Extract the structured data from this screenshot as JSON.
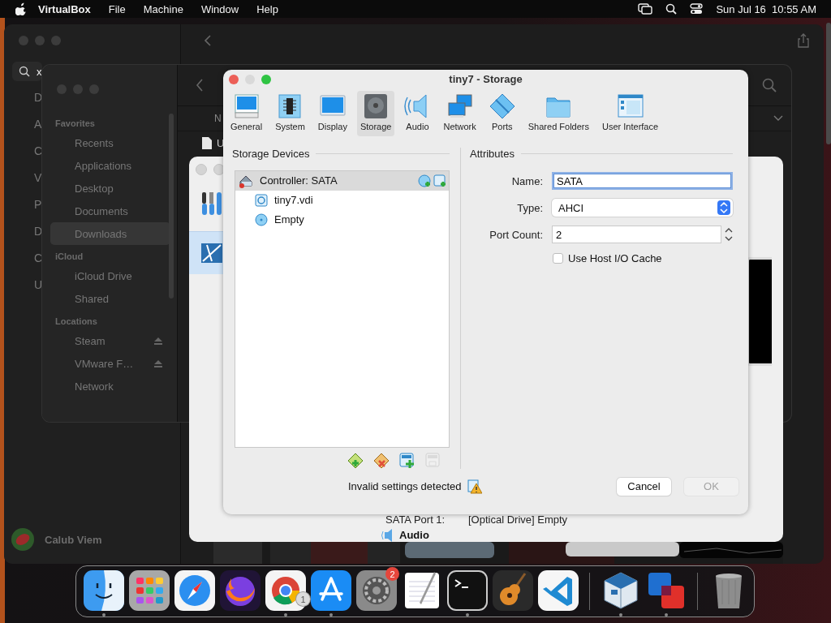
{
  "menu_bar": {
    "app": "VirtualBox",
    "menus": [
      "File",
      "Machine",
      "Window",
      "Help"
    ],
    "clock": "Sun Jul 16  10:55 AM"
  },
  "finder_back": {
    "search_value": "x",
    "sidebar_letters": [
      "D",
      "A",
      "C",
      "V",
      "P",
      "D",
      "C",
      "U"
    ],
    "user": "Calub Viem"
  },
  "finder_front": {
    "sidebar": [
      {
        "heading": "Favorites",
        "items": [
          {
            "label": "Recents",
            "selected": false,
            "ejectable": false
          },
          {
            "label": "Applications",
            "selected": false,
            "ejectable": false
          },
          {
            "label": "Desktop",
            "selected": false,
            "ejectable": false
          },
          {
            "label": "Documents",
            "selected": false,
            "ejectable": false
          },
          {
            "label": "Downloads",
            "selected": true,
            "ejectable": false
          }
        ]
      },
      {
        "heading": "iCloud",
        "items": [
          {
            "label": "iCloud Drive",
            "selected": false,
            "ejectable": false
          },
          {
            "label": "Shared",
            "selected": false,
            "ejectable": false
          }
        ]
      },
      {
        "heading": "Locations",
        "items": [
          {
            "label": "Steam",
            "selected": false,
            "ejectable": true
          },
          {
            "label": "VMware F…",
            "selected": false,
            "ejectable": true
          },
          {
            "label": "Network",
            "selected": false,
            "ejectable": false
          }
        ]
      }
    ],
    "column_1": "N",
    "row_1": "U"
  },
  "vbox_main": {
    "details": [
      {
        "label": "SATA Port 1:",
        "value": "[Optical Drive] Empty"
      }
    ],
    "section": "Audio"
  },
  "dialog": {
    "title": "tiny7 - Storage",
    "pages": [
      {
        "label": "General",
        "kind": "general",
        "selected": false
      },
      {
        "label": "System",
        "kind": "system",
        "selected": false
      },
      {
        "label": "Display",
        "kind": "display",
        "selected": false
      },
      {
        "label": "Storage",
        "kind": "storage",
        "selected": true
      },
      {
        "label": "Audio",
        "kind": "audio",
        "selected": false
      },
      {
        "label": "Network",
        "kind": "network",
        "selected": false
      },
      {
        "label": "Ports",
        "kind": "ports",
        "selected": false
      },
      {
        "label": "Shared Folders",
        "kind": "folders",
        "selected": false
      },
      {
        "label": "User Interface",
        "kind": "ui",
        "selected": false
      }
    ],
    "devices_heading": "Storage Devices",
    "storage_tree": [
      {
        "label": "Controller: SATA",
        "kind": "controller",
        "selected": true,
        "children": [
          {
            "label": "tiny7.vdi",
            "kind": "disk",
            "selected": false
          },
          {
            "label": "Empty",
            "kind": "optical",
            "selected": false
          }
        ]
      }
    ],
    "tree_tools": [
      {
        "kind": "add-controller",
        "disabled": false
      },
      {
        "kind": "remove-controller",
        "disabled": false
      },
      {
        "kind": "add-attachment",
        "disabled": false
      },
      {
        "kind": "remove-attachment",
        "disabled": true
      }
    ],
    "attributes_heading": "Attributes",
    "attributes": [
      {
        "kind": "text",
        "label": "Name:",
        "value": "SATA",
        "focused": true
      },
      {
        "kind": "select",
        "label": "Type:",
        "value": "AHCI"
      },
      {
        "kind": "spin",
        "label": "Port Count:",
        "value": "2"
      },
      {
        "kind": "checkbox",
        "label": "Use Host I/O Cache",
        "checked": false
      }
    ],
    "message": "Invalid settings detected",
    "buttons": [
      {
        "label": "Cancel",
        "disabled": false
      },
      {
        "label": "OK",
        "disabled": true
      }
    ]
  },
  "dock": {
    "apps": [
      {
        "kind": "face",
        "running": true
      },
      {
        "kind": "grid",
        "running": false
      },
      {
        "kind": "compass",
        "running": false
      },
      {
        "kind": "fox",
        "running": false
      },
      {
        "kind": "ring",
        "running": true,
        "badge": {
          "text": "1",
          "kind": "progress"
        }
      },
      {
        "kind": "store",
        "running": true
      },
      {
        "kind": "gear",
        "running": false,
        "badge": {
          "text": "2",
          "kind": "alert"
        }
      },
      {
        "kind": "notepad",
        "running": false
      },
      {
        "kind": "terminal",
        "running": true
      },
      {
        "kind": "guitar",
        "running": false
      },
      {
        "kind": "code",
        "running": false
      },
      {
        "kind": "cube",
        "running": true,
        "group_start": true
      },
      {
        "kind": "squares",
        "running": true
      },
      {
        "kind": "trash",
        "running": false,
        "group_start": true
      }
    ]
  }
}
